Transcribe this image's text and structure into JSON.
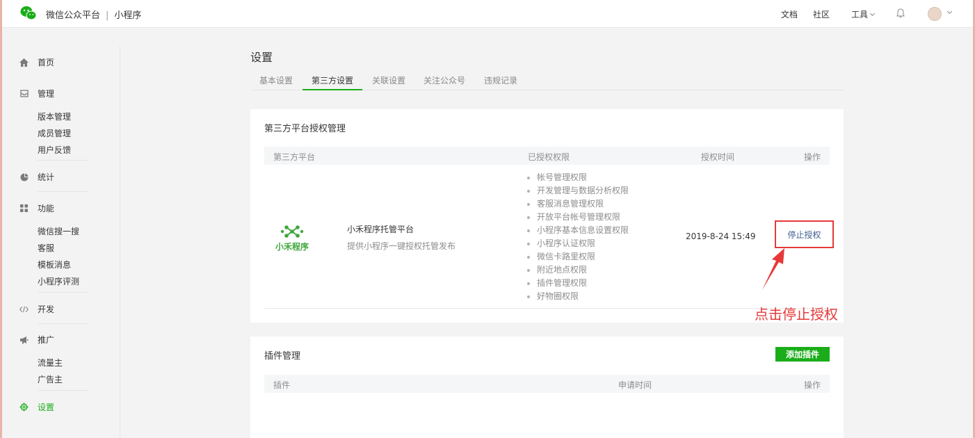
{
  "header": {
    "brand": "微信公众平台",
    "separator": "|",
    "product": "小程序",
    "nav": {
      "docs": "文档",
      "community": "社区",
      "tools": "工具"
    }
  },
  "sidebar": {
    "home": "首页",
    "manage": {
      "title": "管理",
      "items": [
        "版本管理",
        "成员管理",
        "用户反馈"
      ]
    },
    "stats": "统计",
    "features": {
      "title": "功能",
      "items": [
        "微信搜一搜",
        "客服",
        "模板消息",
        "小程序评测"
      ]
    },
    "dev": "开发",
    "promote": {
      "title": "推广",
      "items": [
        "流量主",
        "广告主"
      ]
    },
    "settings": "设置"
  },
  "main": {
    "title": "设置",
    "tabs": [
      "基本设置",
      "第三方设置",
      "关联设置",
      "关注公众号",
      "违规记录"
    ],
    "active_tab": "第三方设置"
  },
  "auth_card": {
    "title": "第三方平台授权管理",
    "columns": [
      "第三方平台",
      "已授权权限",
      "授权时间",
      "操作"
    ],
    "platform": {
      "logo_text": "小禾程序",
      "name": "小禾程序托管平台",
      "description": "提供小程序一键授权托管发布"
    },
    "permissions": [
      "帐号管理权限",
      "开发管理与数据分析权限",
      "客服消息管理权限",
      "开放平台帐号管理权限",
      "小程序基本信息设置权限",
      "小程序认证权限",
      "微信卡路里权限",
      "附近地点权限",
      "插件管理权限",
      "好物圈权限"
    ],
    "auth_time": "2019-8-24 15:49",
    "action": "停止授权"
  },
  "annotation": "点击停止授权",
  "plugin_card": {
    "title": "插件管理",
    "add_button": "添加插件",
    "columns": [
      "插件",
      "申请时间",
      "操作"
    ]
  },
  "colors": {
    "brand_green": "#1aad19",
    "annotation_red": "#e53939",
    "link_blue": "#3e5e8e"
  }
}
